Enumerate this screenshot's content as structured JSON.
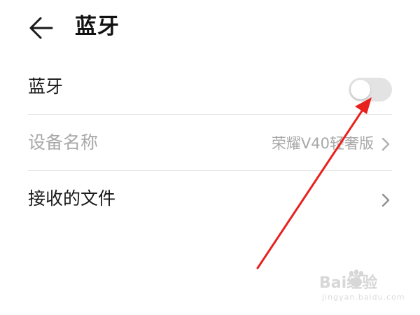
{
  "header": {
    "title": "蓝牙",
    "back_icon": "back-arrow-icon"
  },
  "settings": {
    "bluetooth": {
      "label": "蓝牙",
      "toggle_on": false
    },
    "device_name": {
      "label": "设备名称",
      "value": "荣耀V40轻奢版",
      "enabled": false,
      "chevron_icon": "chevron-right-icon"
    },
    "received_files": {
      "label": "接收的文件",
      "chevron_icon": "chevron-right-icon"
    }
  },
  "annotation": {
    "type": "red-arrow",
    "color": "#e8211e"
  },
  "watermark": {
    "brand": "Bai经验",
    "url": "jingyan.baidu.com"
  },
  "colors": {
    "toggle_off_track": "#e3e3e3",
    "disabled_text": "#a8a8a8",
    "divider": "#e6e6e6"
  }
}
